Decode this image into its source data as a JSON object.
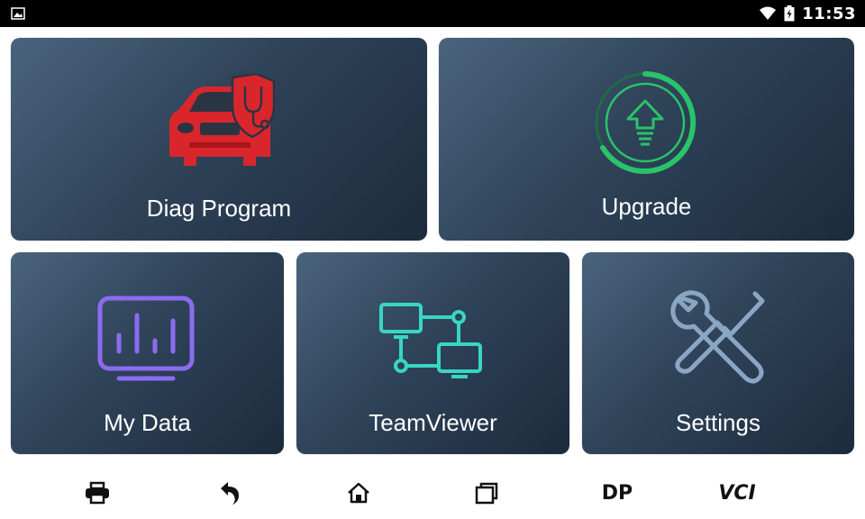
{
  "status_bar": {
    "time": "11:53",
    "icons": [
      "image-notification-icon",
      "wifi-icon",
      "battery-icon"
    ]
  },
  "tiles": {
    "diag_program": {
      "label": "Diag Program",
      "icon": "car-diagnosis-icon"
    },
    "upgrade": {
      "label": "Upgrade",
      "icon": "upgrade-arrow-icon"
    },
    "my_data": {
      "label": "My Data",
      "icon": "data-monitor-icon"
    },
    "teamviewer": {
      "label": "TeamViewer",
      "icon": "network-computers-icon"
    },
    "settings": {
      "label": "Settings",
      "icon": "wrench-screwdriver-icon"
    }
  },
  "nav_bar": {
    "dp_label": "DP",
    "vci_label": "VCI",
    "icons": [
      "print-icon",
      "back-icon",
      "home-icon",
      "recent-apps-icon"
    ]
  },
  "colors": {
    "tile_dark": "#1c2b3c",
    "tile_light": "#4a647d",
    "car_red": "#d9262c",
    "upgrade_green": "#29c36a",
    "data_purple": "#8b6cf0",
    "network_teal": "#38d6c4",
    "tools_blue": "#8aa6c4"
  }
}
